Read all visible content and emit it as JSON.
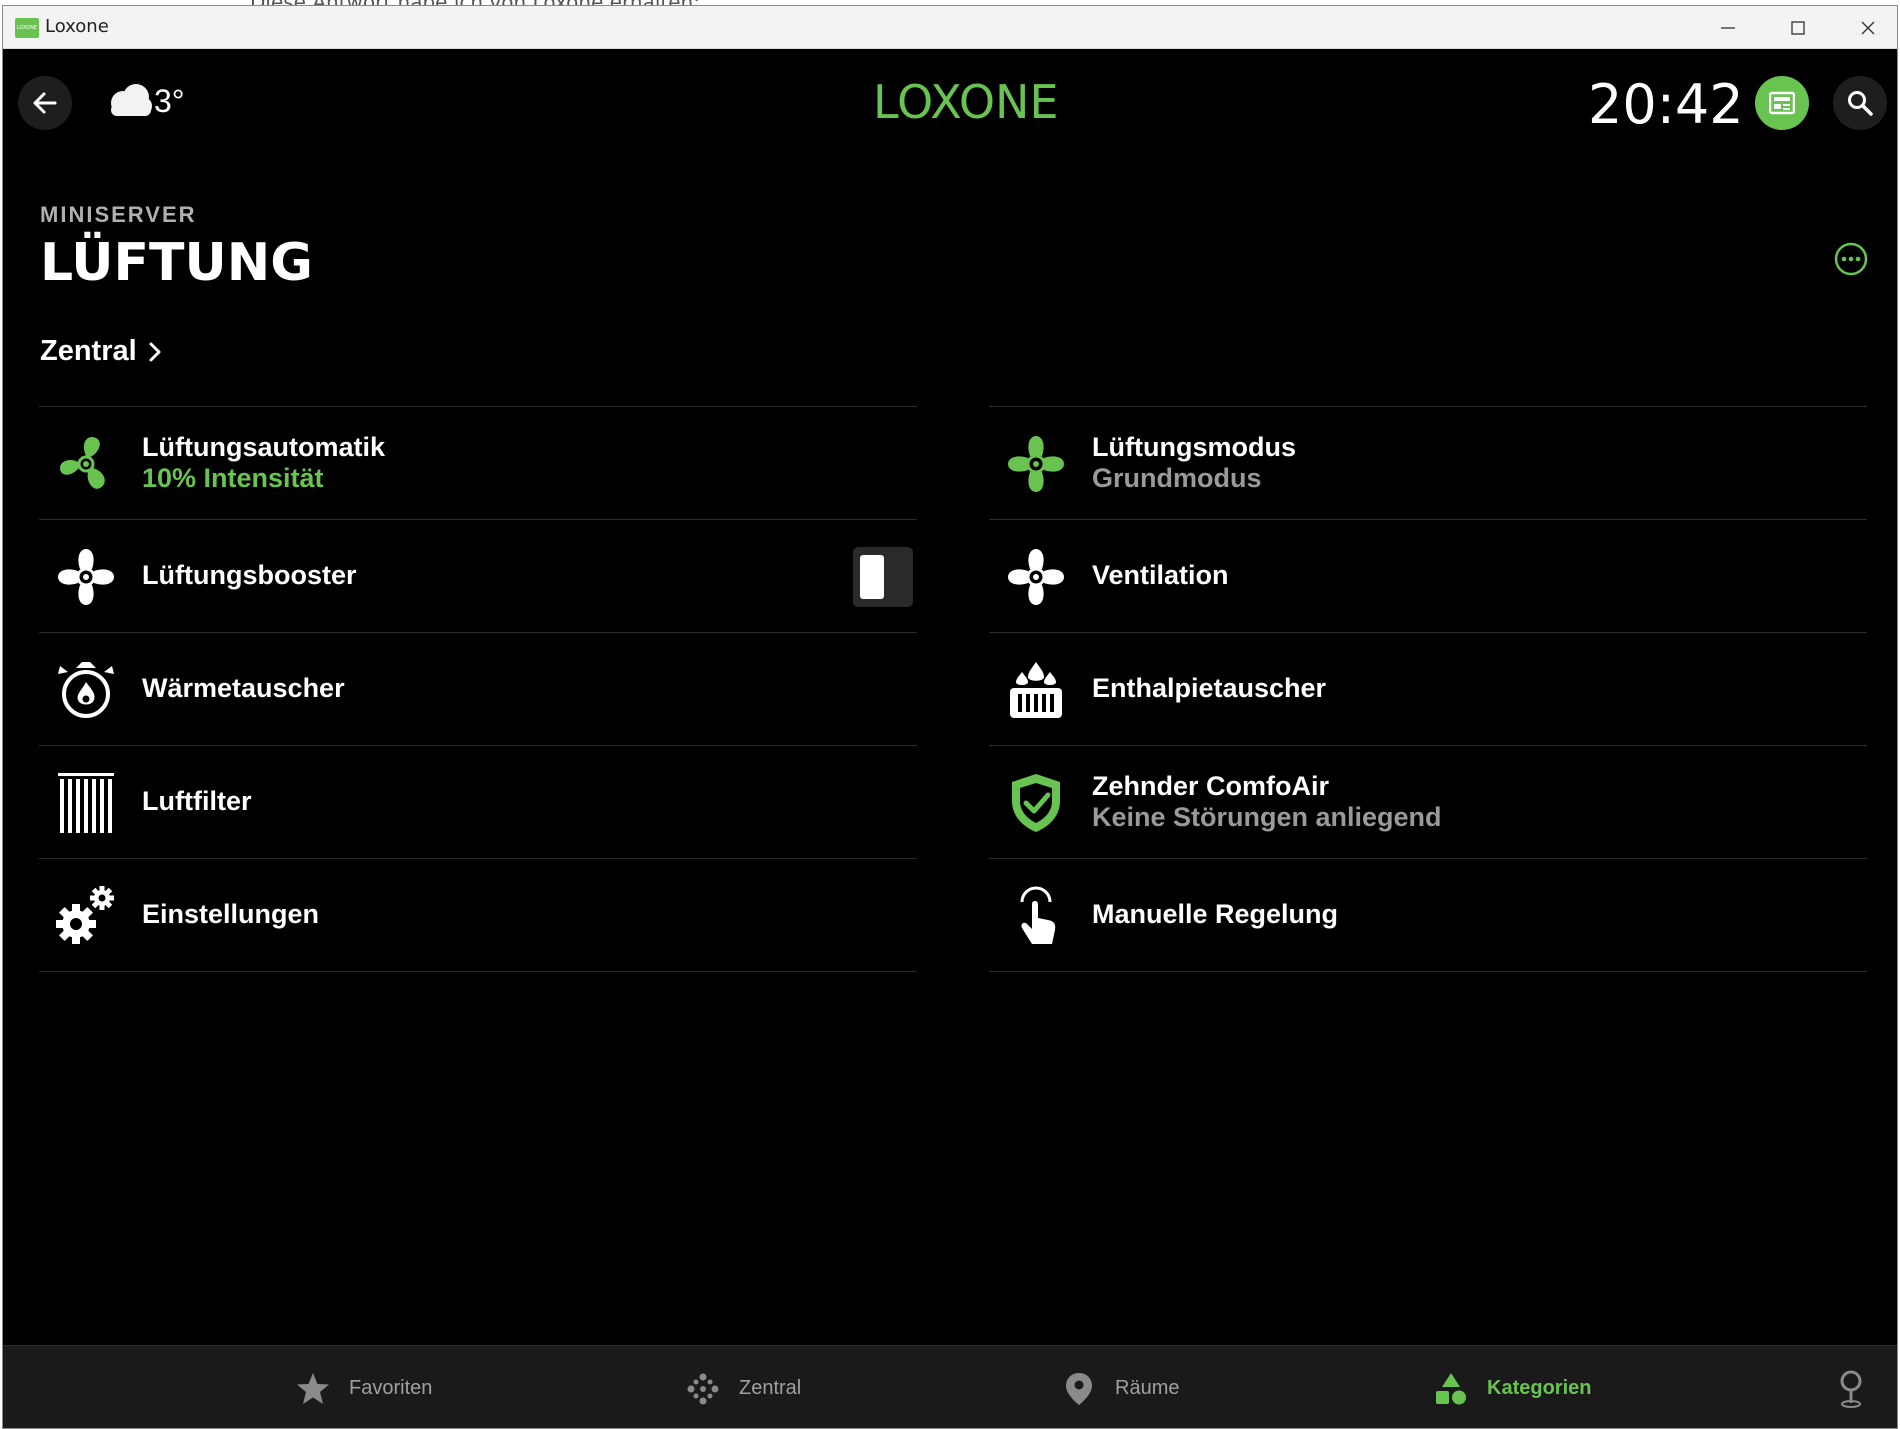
{
  "background_text": "Diese Antwort habe ich von Loxone erhalten:",
  "window": {
    "title": "Loxone",
    "app_icon_text": "LOXONE"
  },
  "header": {
    "temperature": "3°",
    "brand": "LOXONE",
    "time": "20:42"
  },
  "page": {
    "subtitle": "MINISERVER",
    "title": "LÜFTUNG",
    "section_link": "Zentral"
  },
  "left_column": [
    {
      "label": "Lüftungsautomatik",
      "sub": "10% Intensität",
      "icon": "fan-green-icon"
    },
    {
      "label": "Lüftungsbooster",
      "icon": "fan-icon",
      "toggle": "off"
    },
    {
      "label": "Wärmetauscher",
      "icon": "heat-exchanger-icon"
    },
    {
      "label": "Luftfilter",
      "icon": "filter-icon"
    },
    {
      "label": "Einstellungen",
      "icon": "gears-icon"
    }
  ],
  "right_column": [
    {
      "label": "Lüftungsmodus",
      "sub": "Grundmodus",
      "icon": "fan-green-icon"
    },
    {
      "label": "Ventilation",
      "icon": "fan-icon"
    },
    {
      "label": "Enthalpietauscher",
      "icon": "enthalpy-exchanger-icon"
    },
    {
      "label": "Zehnder ComfoAir",
      "sub": "Keine Störungen anliegend",
      "icon": "shield-check-icon"
    },
    {
      "label": "Manuelle Regelung",
      "icon": "touch-hand-icon"
    }
  ],
  "bottom_nav": [
    {
      "label": "Favoriten",
      "icon": "star-icon"
    },
    {
      "label": "Zentral",
      "icon": "dots-icon"
    },
    {
      "label": "Räume",
      "icon": "location-pin-icon"
    },
    {
      "label": "Kategorien",
      "icon": "shapes-icon",
      "active": true
    },
    {
      "label": "",
      "icon": "pin-icon"
    }
  ],
  "colors": {
    "accent": "#69c350",
    "background": "#000000",
    "divider": "#2b2b2b",
    "muted_text": "#9a9a9a"
  }
}
